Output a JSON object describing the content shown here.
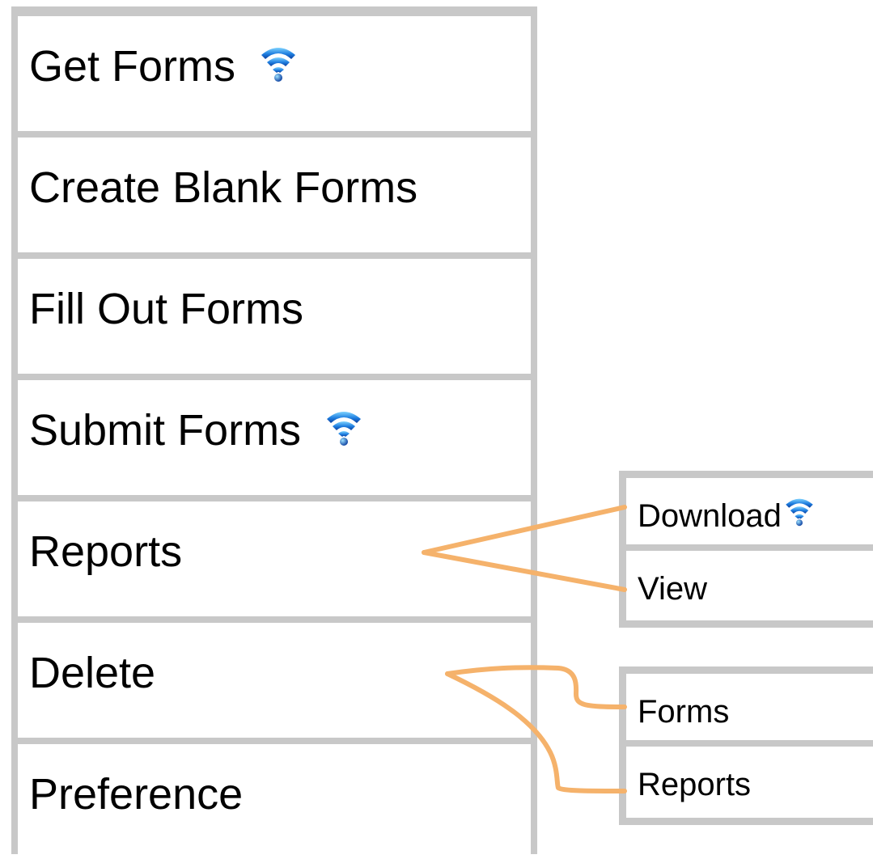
{
  "menu": {
    "items": [
      {
        "label": "Get Forms",
        "icon": "wifi-icon"
      },
      {
        "label": "Create Blank Forms"
      },
      {
        "label": "Fill Out Forms"
      },
      {
        "label": "Submit Forms",
        "icon": "wifi-icon"
      },
      {
        "label": "Reports"
      },
      {
        "label": "Delete"
      },
      {
        "label": "Preference"
      }
    ]
  },
  "reports_submenu": {
    "items": [
      {
        "label": "Download",
        "icon": "wifi-icon"
      },
      {
        "label": "View"
      }
    ]
  },
  "delete_submenu": {
    "items": [
      {
        "label": "Forms"
      },
      {
        "label": "Reports"
      }
    ]
  },
  "colors": {
    "frame": "#c8c8c8",
    "connector": "#f5b26b",
    "icon": "#1a6fd1"
  }
}
